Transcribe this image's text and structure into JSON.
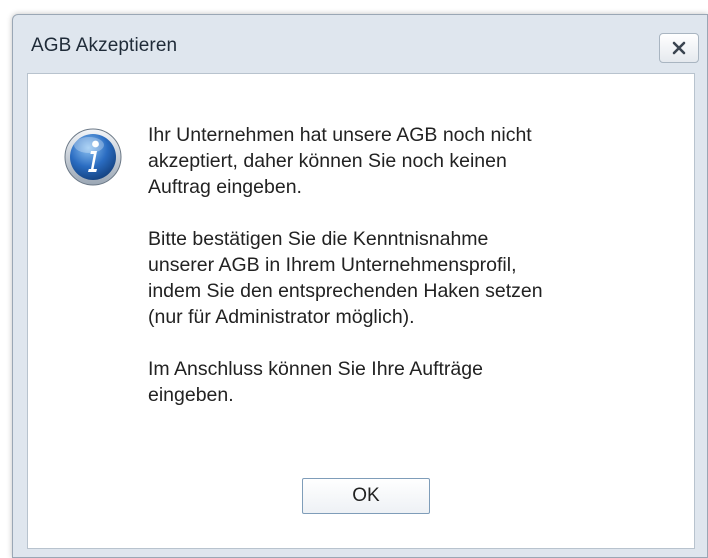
{
  "dialog": {
    "title": "AGB Akzeptieren",
    "close_glyph": "✕",
    "icon": "info-icon",
    "message_paragraphs": [
      "Ihr Unternehmen hat unsere AGB noch nicht\nakzeptiert, daher können Sie noch keinen\nAuftrag eingeben.",
      "Bitte bestätigen Sie die Kenntnisnahme\nunserer AGB in Ihrem Unternehmensprofil,\nindem Sie den entsprechenden Haken setzen\n(nur für Administrator möglich).",
      "Im Anschluss können Sie Ihre Aufträge\neingeben."
    ],
    "ok_label": "OK"
  },
  "colors": {
    "titlebar_bg": "#dfe6ee",
    "icon_blue": "#2a6cc1",
    "button_border": "#7f9db9"
  }
}
